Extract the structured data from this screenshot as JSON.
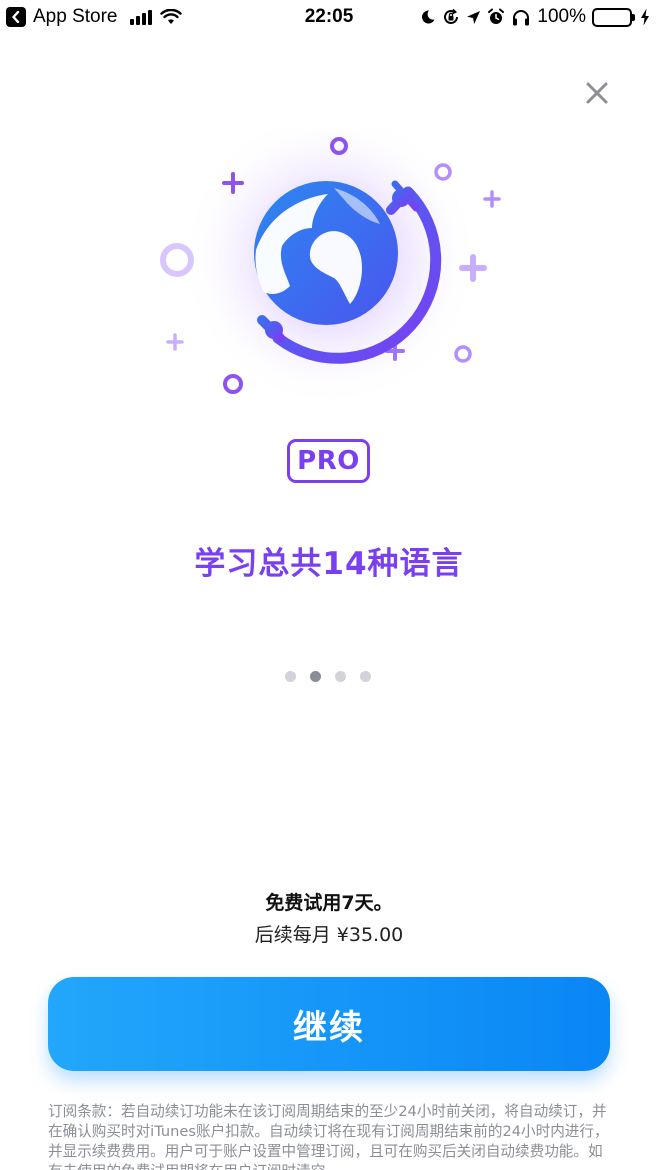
{
  "status_bar": {
    "back_app": "App Store",
    "time": "22:05",
    "battery_percent": "100%",
    "icons": [
      "signal-icon",
      "wifi-icon",
      "moon-icon",
      "orientation-lock-icon",
      "location-icon",
      "alarm-icon",
      "headphones-icon",
      "battery-icon",
      "charging-icon"
    ]
  },
  "close": {
    "icon": "close-icon"
  },
  "hero": {
    "icon": "globe-icon"
  },
  "badge": {
    "label": "PRO"
  },
  "headline": "学习总共14种语言",
  "pager": {
    "count": 4,
    "active_index": 1
  },
  "offer": {
    "trial": "免费试用7天。",
    "price": "后续每月 ¥35.00"
  },
  "continue_button": {
    "label": "继续"
  },
  "terms": "订阅条款：若自动续订功能未在该订阅周期结束的至少24小时前关闭，将自动续订，并在确认购买时对iTunes账户扣款。自动续订将在现有订阅周期结束前的24小时内进行，并显示续费费用。用户可于账户设置中管理订阅，且可在购买后关闭自动续费功能。如有未使用的免费试用期将在用户订阅时清空。",
  "colors": {
    "accent_purple": "#7b3ff2",
    "button_blue": "#1a97f8",
    "globe_blue": "#2f7df2",
    "stand_purple": "#6a4cf0"
  }
}
